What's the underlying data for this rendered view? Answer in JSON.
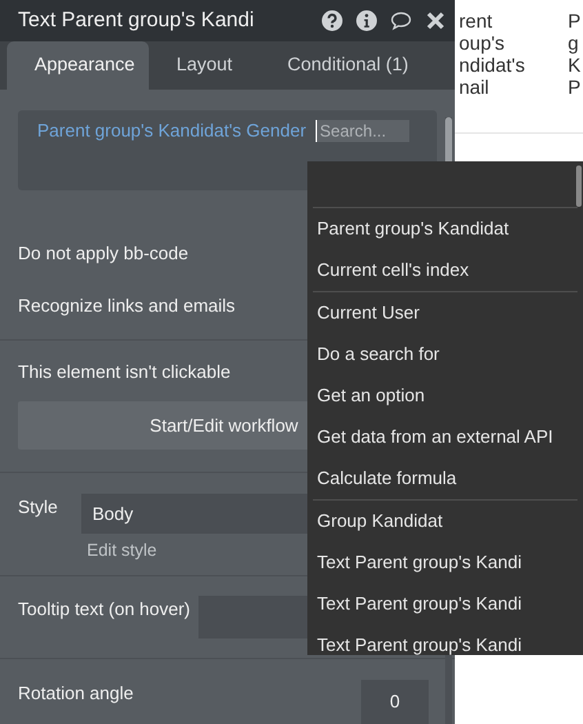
{
  "panel": {
    "title": "Text Parent group's Kandi",
    "tabs": [
      {
        "label": "Appearance",
        "selected": true
      },
      {
        "label": "Layout",
        "selected": false
      },
      {
        "label": "Conditional (1)",
        "selected": false
      }
    ],
    "expression": {
      "text": "Parent group's Kandidat's Gender",
      "search_placeholder": "Search..."
    },
    "options": [
      "Do not apply bb-code",
      "Recognize links and emails"
    ],
    "clickable_note": "This element isn't clickable",
    "workflow_button": "Start/Edit workflow",
    "style": {
      "label": "Style",
      "value": "Body",
      "edit_link": "Edit style"
    },
    "tooltip": {
      "label": "Tooltip text (on hover)"
    },
    "rotation": {
      "label": "Rotation angle",
      "value": "0"
    }
  },
  "canvas": {
    "column_1": [
      "rent",
      "oup's",
      "ndidat's",
      "nail"
    ],
    "column_2": [
      "P",
      "g",
      "K",
      "P"
    ]
  },
  "dropdown": {
    "sections": [
      [
        "Parent group's Kandidat",
        "Current cell's index"
      ],
      [
        "Current User",
        "Do a search for",
        "Get an option",
        "Get data from an external API",
        "Calculate formula"
      ],
      [
        "Group Kandidat",
        "Text Parent group's Kandi",
        "Text Parent group's Kandi",
        "Text Parent group's Kandi"
      ]
    ]
  }
}
